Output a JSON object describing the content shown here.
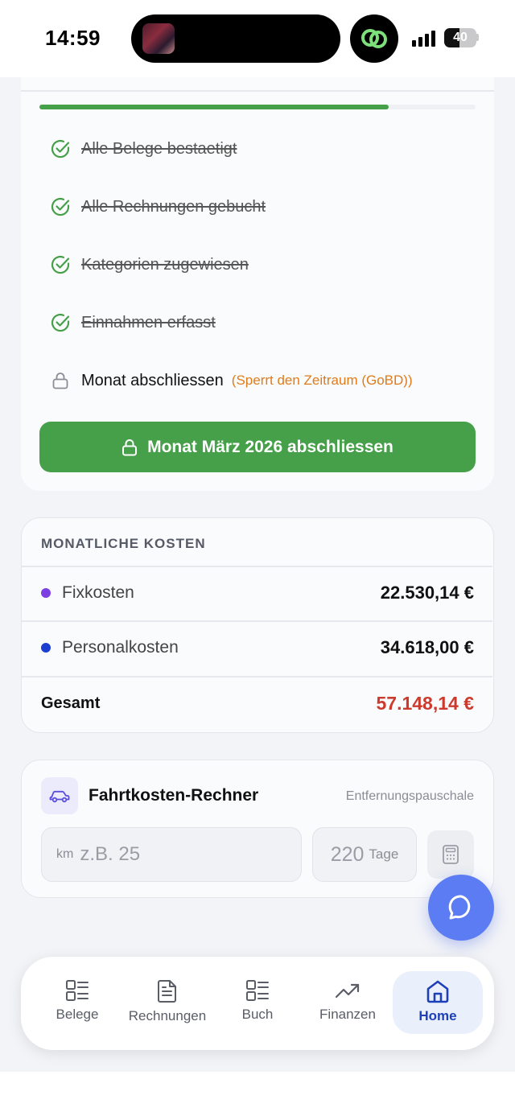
{
  "status_bar": {
    "time": "14:59",
    "battery": "40"
  },
  "checklist": {
    "progress_fraction": 0.8,
    "items": [
      {
        "label": "Alle Belege bestaetigt",
        "done": true
      },
      {
        "label": "Alle Rechnungen gebucht",
        "done": true
      },
      {
        "label": "Kategorien zugewiesen",
        "done": true
      },
      {
        "label": "Einnahmen erfasst",
        "done": true
      }
    ],
    "lock_item": {
      "label": "Monat abschliessen",
      "note": "(Sperrt den Zeitraum (GoBD))"
    },
    "close_button": "Monat März 2026 abschliessen"
  },
  "costs": {
    "heading": "MONATLICHE KOSTEN",
    "rows": [
      {
        "name": "Fixkosten",
        "value": "22.530,14 €",
        "color": "#7b3fe4"
      },
      {
        "name": "Personalkosten",
        "value": "34.618,00 €",
        "color": "#1d3fcf"
      }
    ],
    "total": {
      "name": "Gesamt",
      "value": "57.148,14 €",
      "color": "#cc3a2e"
    }
  },
  "fahrtkosten": {
    "title": "Fahrtkosten-Rechner",
    "subtitle": "Entfernungspauschale",
    "km_unit": "km",
    "km_placeholder": "z.B. 25",
    "days_value": "220",
    "days_unit": "Tage"
  },
  "nav": {
    "tabs": [
      {
        "label": "Belege",
        "icon": "list-icon"
      },
      {
        "label": "Rechnungen",
        "icon": "document-icon"
      },
      {
        "label": "Buch",
        "icon": "list-icon"
      },
      {
        "label": "Finanzen",
        "icon": "trending-up-icon"
      },
      {
        "label": "Home",
        "icon": "home-icon",
        "active": true
      }
    ]
  },
  "colors": {
    "accent_green": "#45a049",
    "brand_blue": "#1d3fb8",
    "fab": "#5b7cf2"
  }
}
